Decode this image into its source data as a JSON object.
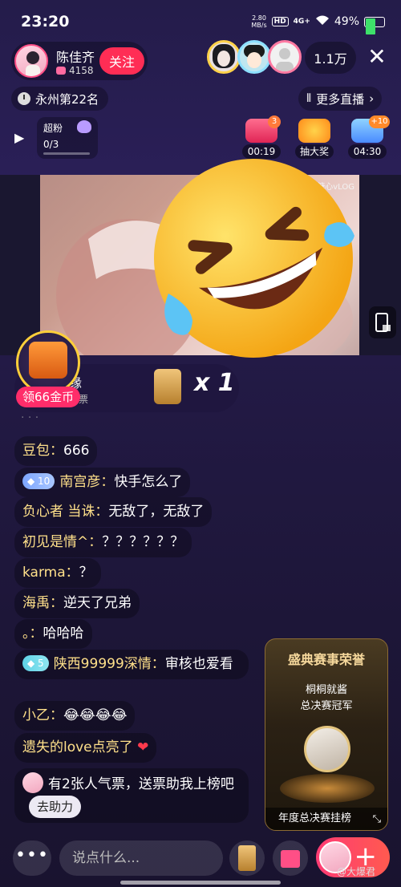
{
  "status": {
    "time": "23:20",
    "net_speed": "2.80\nMB/s",
    "hd": "HD",
    "signal": "4G+",
    "battery": "49%",
    "battery_level": 0.49
  },
  "host": {
    "name": "陈佳齐",
    "fans": "4158",
    "follow_label": "关注"
  },
  "viewers": {
    "count": "1.1万"
  },
  "rank": {
    "label": "永州第22名"
  },
  "more_live": {
    "label": "更多直播"
  },
  "fan_club": {
    "title": "超粉",
    "progress": "0/3"
  },
  "tools": [
    {
      "label": "00:19",
      "badge": "3"
    },
    {
      "label": "抽大奖"
    },
    {
      "label": "04:30",
      "badge": "+10"
    }
  ],
  "gift_banner": {
    "user": "缘",
    "desc": "度票",
    "multiplier": "x 1"
  },
  "chest": {
    "label": "领66金币"
  },
  "chat": [
    {
      "user": "豆包：",
      "text": "666"
    },
    {
      "level": "10",
      "user": "南宫彦：",
      "text": "快手怎么了"
    },
    {
      "user": "负心者 当诛：",
      "text": "无敌了，无敌了"
    },
    {
      "user": "初见是情^：",
      "text": "？？？？？？"
    },
    {
      "user": "karma：",
      "text": "？"
    },
    {
      "user": "海禹：",
      "text": "逆天了兄弟"
    },
    {
      "user": "。：",
      "text": "哈哈哈"
    },
    {
      "level": "5",
      "user": "陕西99999深情：",
      "text": "审核也爱看"
    },
    {
      "user": "小乙：",
      "text": "😂😂😂😂"
    },
    {
      "user": "遗失的love点亮了",
      "text": "❤"
    }
  ],
  "vote_prompt": {
    "text": "有2张人气票，送票助我上榜吧",
    "button": "去助力"
  },
  "event_card": {
    "title": "盛典赛事荣誉",
    "name": "桐桐就酱",
    "subtitle": "总决赛冠军",
    "footer": "年度总决赛挂榜"
  },
  "input": {
    "placeholder": "说点什么..."
  },
  "watermark": "@大爆君"
}
